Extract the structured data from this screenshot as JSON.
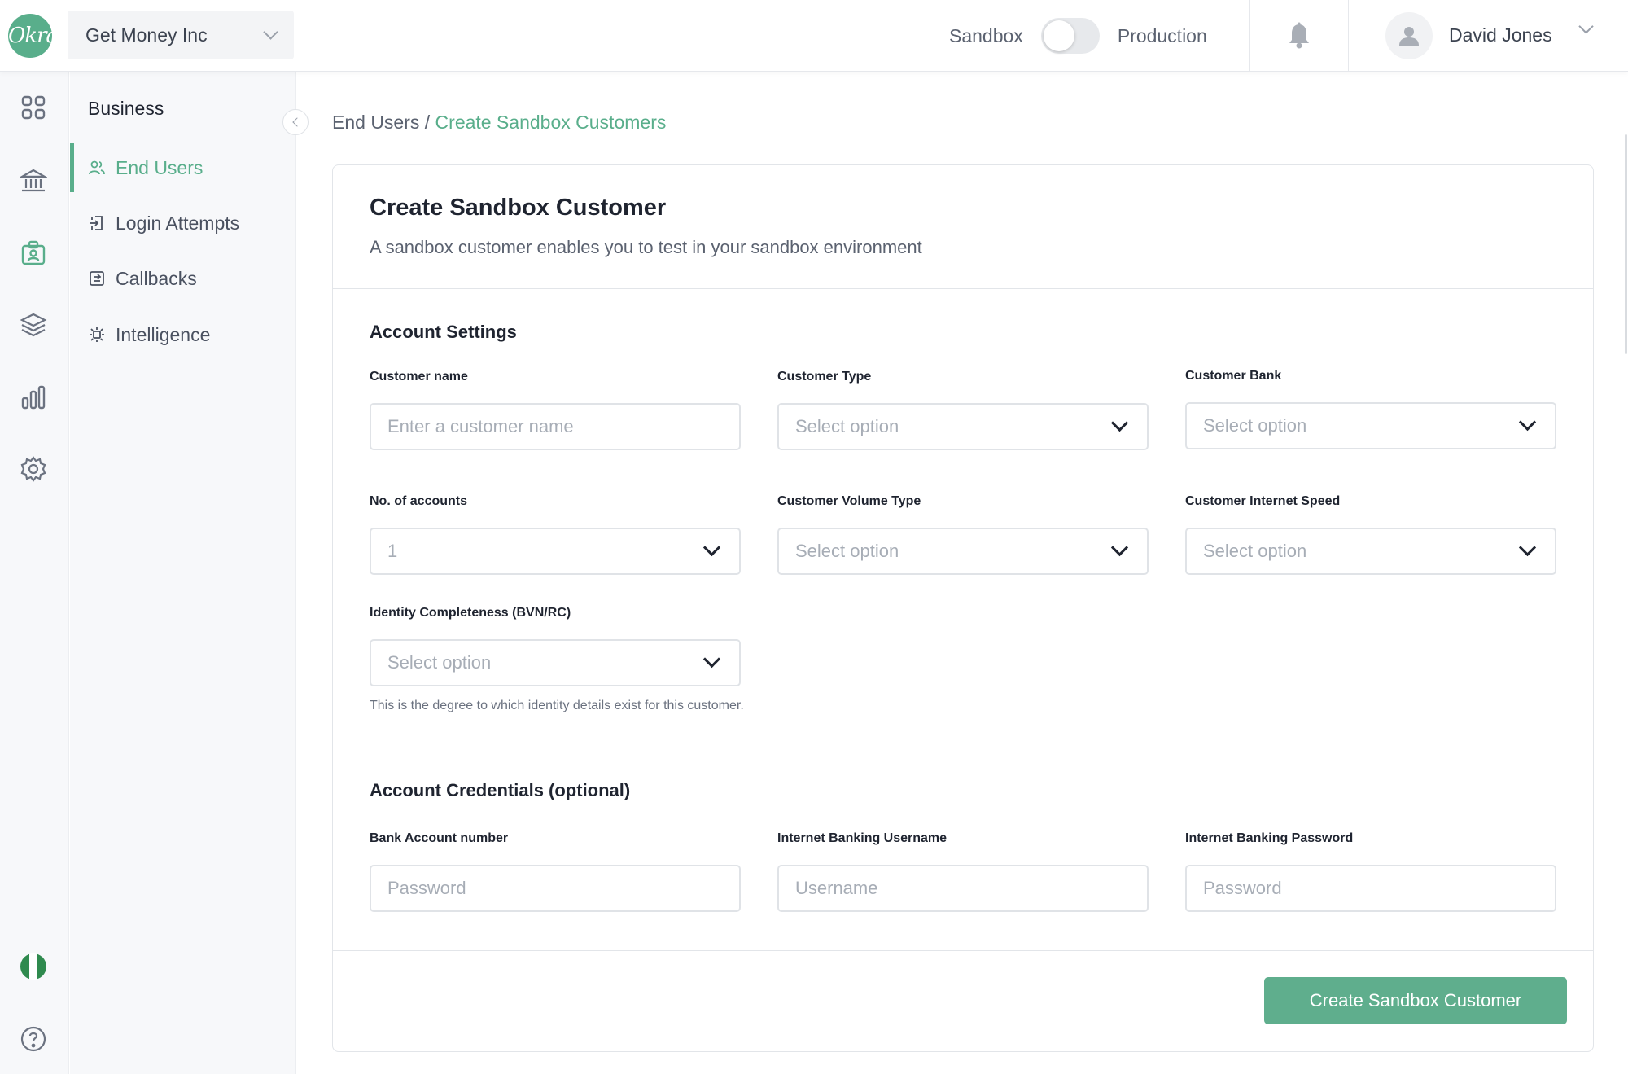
{
  "brand": {
    "logo_text": "Okra",
    "accent": "#59ae8b"
  },
  "header": {
    "org_name": "Get Money Inc",
    "env_left": "Sandbox",
    "env_right": "Production",
    "user_name": "David Jones"
  },
  "rail": {
    "icons": [
      "dashboard-grid-icon",
      "bank-icon",
      "id-badge-icon",
      "layers-icon",
      "bar-chart-icon",
      "settings-gear-icon",
      "nigeria-flag-icon",
      "help-icon"
    ]
  },
  "sidebar": {
    "title": "Business",
    "items": [
      {
        "label": "End Users",
        "icon": "users-icon",
        "active": true
      },
      {
        "label": "Login Attempts",
        "icon": "login-icon",
        "active": false
      },
      {
        "label": "Callbacks",
        "icon": "callbacks-icon",
        "active": false
      },
      {
        "label": "Intelligence",
        "icon": "intelligence-icon",
        "active": false
      }
    ]
  },
  "breadcrumb": {
    "parent": "End Users",
    "separator": " / ",
    "current": "Create Sandbox Customers"
  },
  "form": {
    "title": "Create Sandbox Customer",
    "subtitle": "A sandbox customer enables you to test in your sandbox environment",
    "account_settings": {
      "heading": "Account Settings",
      "customer_name": {
        "label": "Customer name",
        "placeholder": "Enter a customer name"
      },
      "customer_type": {
        "label": "Customer Type",
        "placeholder": "Select option"
      },
      "customer_bank": {
        "label": "Customer Bank",
        "placeholder": "Select option"
      },
      "num_accounts": {
        "label": "No. of accounts",
        "value": "1"
      },
      "volume_type": {
        "label": "Customer Volume Type",
        "placeholder": "Select option"
      },
      "internet_speed": {
        "label": "Customer Internet Speed",
        "placeholder": "Select option"
      },
      "identity": {
        "label": "Identity Completeness (BVN/RC)",
        "placeholder": "Select option",
        "help": "This is the degree to which identity details exist for this customer."
      }
    },
    "credentials": {
      "heading": "Account Credentials (optional)",
      "bank_account": {
        "label": "Bank Account number",
        "placeholder": "Password"
      },
      "ib_username": {
        "label": "Internet Banking Username",
        "placeholder": "Username"
      },
      "ib_password": {
        "label": "Internet Banking Password",
        "placeholder": "Password"
      }
    },
    "submit_label": "Create Sandbox Customer"
  }
}
